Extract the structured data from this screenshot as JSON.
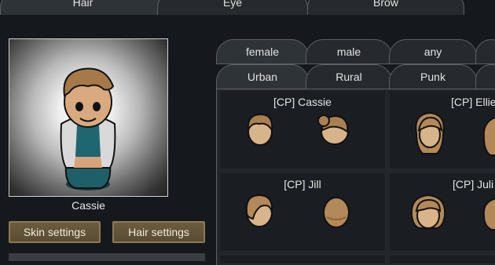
{
  "top_tabs": [
    {
      "label": "Hair",
      "active": true
    },
    {
      "label": "Eye",
      "active": false
    },
    {
      "label": "Brow",
      "active": false
    }
  ],
  "character": {
    "name": "Cassie"
  },
  "buttons": {
    "skin": "Skin settings",
    "hair": "Hair settings"
  },
  "filter_tabs_gender": [
    {
      "label": "female",
      "active": true
    },
    {
      "label": "male",
      "active": false
    },
    {
      "label": "any",
      "active": false
    }
  ],
  "filter_tabs_style": [
    {
      "label": "Urban",
      "active": true
    },
    {
      "label": "Rural",
      "active": false
    },
    {
      "label": "Punk",
      "active": false
    }
  ],
  "hair_cells": [
    {
      "title": "[CP] Cassie"
    },
    {
      "title": "[CP] Ellie"
    },
    {
      "title": "[CP] Jill"
    },
    {
      "title": "[CP] Juli"
    }
  ],
  "colors": {
    "accent_button": "#5f5138",
    "background": "#15191d",
    "hair": "#b08552"
  }
}
